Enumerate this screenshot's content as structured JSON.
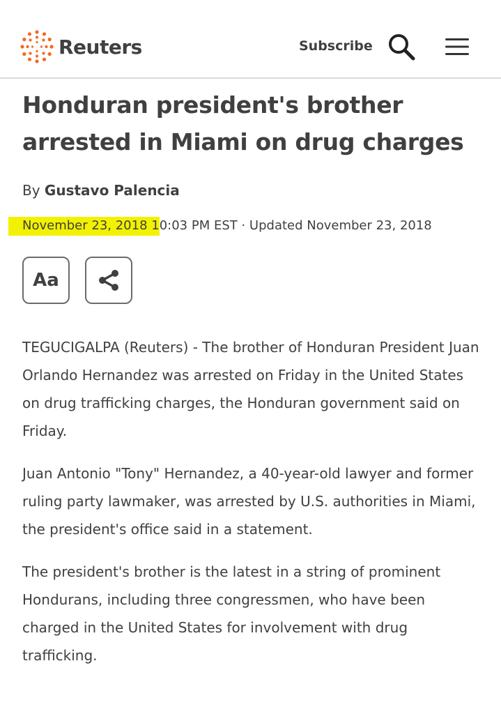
{
  "header": {
    "brand": "Reuters",
    "subscribe_label": "Subscribe",
    "brand_color": "#f26b21"
  },
  "article": {
    "headline": "Honduran president's brother arrested in Miami on drug charges",
    "byline_prefix": "By ",
    "author": "Gustavo Palencia",
    "date_highlighted": "November 23, 2018 1",
    "date_rest": "0:03 PM EST · Updated November 23, 2018",
    "highlight_color": "#f2f200",
    "paragraphs": [
      "TEGUCIGALPA (Reuters) - The brother of Honduran President Juan Orlando Hernandez was arrested on Friday in the United States on drug trafficking charges, the Honduran government said on Friday.",
      "Juan Antonio \"Tony\" Hernandez, a 40-year-old lawyer and former ruling party lawmaker, was arrested by U.S. authorities in Miami, the president's office said in a statement.",
      "The president's brother is the latest in a string of prominent Hondurans, including three congressmen, who have been charged in the United States for involvement with drug trafficking."
    ]
  },
  "tools": {
    "font_size_label": "Aa"
  },
  "icons": [
    "reuters-logo-icon",
    "search-icon",
    "menu-icon",
    "share-icon"
  ]
}
